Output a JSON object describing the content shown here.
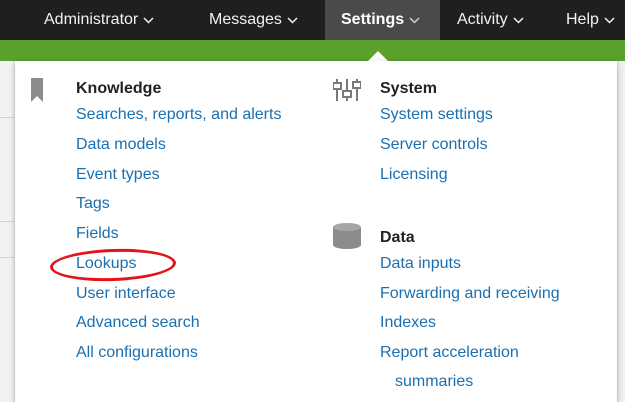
{
  "topnav": {
    "items": [
      {
        "label": "Administrator",
        "icon": "chevron-down-icon"
      },
      {
        "label": "Messages",
        "icon": "chevron-down-icon"
      },
      {
        "label": "Settings",
        "icon": "chevron-down-icon",
        "active": true
      },
      {
        "label": "Activity",
        "icon": "chevron-down-icon"
      },
      {
        "label": "Help",
        "icon": "chevron-down-icon"
      }
    ]
  },
  "settings_menu": {
    "knowledge": {
      "heading": "Knowledge",
      "icon": "bookmark-icon",
      "items": [
        "Searches, reports, and alerts",
        "Data models",
        "Event types",
        "Tags",
        "Fields",
        "Lookups",
        "User interface",
        "Advanced search",
        "All configurations"
      ]
    },
    "system": {
      "heading": "System",
      "icon": "sliders-icon",
      "items": [
        "System settings",
        "Server controls",
        "Licensing"
      ]
    },
    "data": {
      "heading": "Data",
      "icon": "database-icon",
      "items": [
        "Data inputs",
        "Forwarding and receiving",
        "Indexes",
        "Report acceleration",
        "summaries"
      ]
    }
  },
  "colors": {
    "topbar": "#1f1f1f",
    "active_tab": "#4a4a4a",
    "app_bar": "#5aa02c",
    "link": "#1a6fb0",
    "annotation": "#e3141b"
  }
}
